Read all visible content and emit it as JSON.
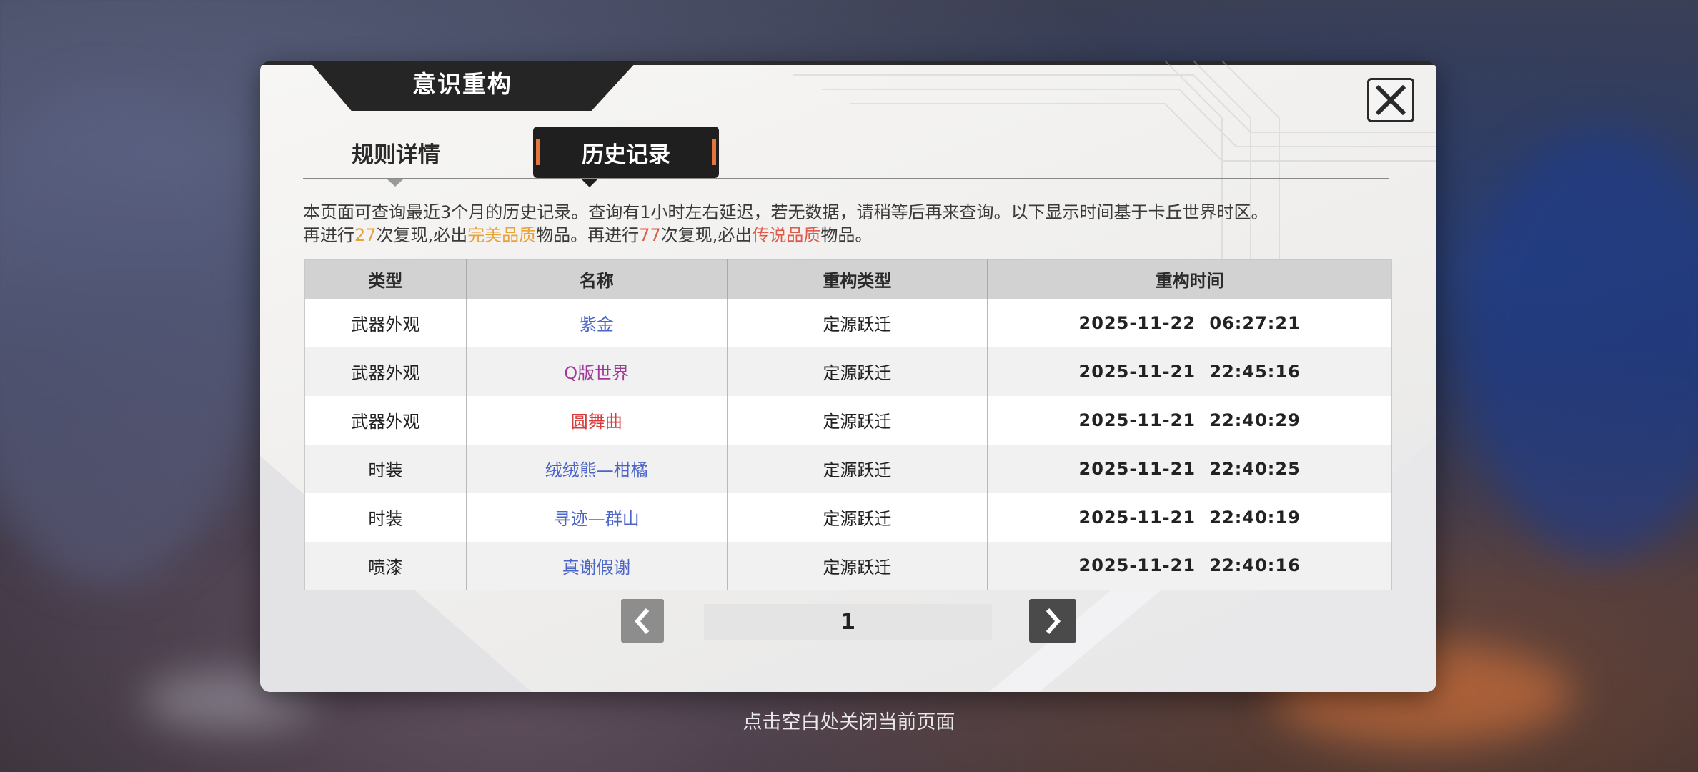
{
  "dialog": {
    "title": "意识重构",
    "tabs": [
      {
        "label": "规则详情",
        "active": false
      },
      {
        "label": "历史记录",
        "active": true
      }
    ],
    "info_line1": "本页面可查询最近3个月的历史记录。查询有1小时左右延迟，若无数据，请稍等后再来查询。以下显示时间基于卡丘世界时区。",
    "info_line2": {
      "p1": "再进行",
      "n1": "27",
      "p2": "次复现,必出",
      "q1": "完美品质",
      "p3": "物品。再进行",
      "n2": "77",
      "p4": "次复现,必出",
      "q2": "传说品质",
      "p5": "物品。"
    },
    "table": {
      "headers": [
        "类型",
        "名称",
        "重构类型",
        "重构时间"
      ],
      "rows": [
        {
          "type": "武器外观",
          "name": "紫金",
          "name_color": "#4a64c8",
          "rebuild": "定源跃迁",
          "time": "2025-11-22 06:27:21"
        },
        {
          "type": "武器外观",
          "name": "Q版世界",
          "name_color": "#a0399a",
          "rebuild": "定源跃迁",
          "time": "2025-11-21 22:45:16"
        },
        {
          "type": "武器外观",
          "name": "圆舞曲",
          "name_color": "#d83a3a",
          "rebuild": "定源跃迁",
          "time": "2025-11-21 22:40:29"
        },
        {
          "type": "时装",
          "name": "绒绒熊—柑橘",
          "name_color": "#4a64c8",
          "rebuild": "定源跃迁",
          "time": "2025-11-21 22:40:25"
        },
        {
          "type": "时装",
          "name": "寻迹—群山",
          "name_color": "#4a64c8",
          "rebuild": "定源跃迁",
          "time": "2025-11-21 22:40:19"
        },
        {
          "type": "喷漆",
          "name": "真谢假谢",
          "name_color": "#4a64c8",
          "rebuild": "定源跃迁",
          "time": "2025-11-21 22:40:16"
        }
      ]
    },
    "pager": {
      "page": "1",
      "prev_icon": "chevron-left-icon",
      "next_icon": "chevron-right-icon"
    },
    "close_icon": "close-icon"
  },
  "footer": {
    "hint": "点击空白处关闭当前页面"
  },
  "colors": {
    "gold": "#e8a23a",
    "red": "#e05a4a",
    "tab_active_bg": "#1f1f1f",
    "tab_accent": "#e2763d"
  }
}
